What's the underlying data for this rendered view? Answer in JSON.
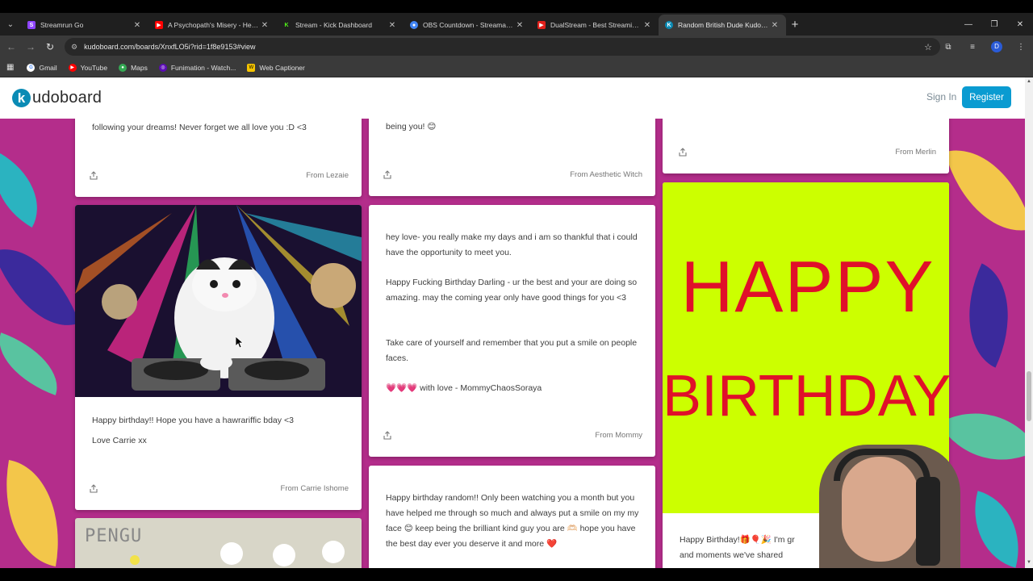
{
  "browser": {
    "tabs": [
      {
        "label": "Streamrun Go",
        "icon": "streamrun-icon",
        "color": "#8e44ff",
        "active": false
      },
      {
        "label": "A Psychopath's Misery - Heartl",
        "icon": "youtube-icon",
        "color": "#ff0000",
        "active": false
      },
      {
        "label": "Stream - Kick Dashboard",
        "icon": "kick-icon",
        "color": "#53fc18",
        "active": false
      },
      {
        "label": "OBS Countdown - Streamable",
        "icon": "chrome-icon",
        "color": "#4285f4",
        "active": false
      },
      {
        "label": "DualStream - Best Streaming Ap",
        "icon": "dualstream-icon",
        "color": "#e0201b",
        "active": false
      },
      {
        "label": "Random British Dude Kudoboar",
        "icon": "kudoboard-icon",
        "color": "#0a8bb5",
        "active": true
      }
    ],
    "url": "kudoboard.com/boards/XnxfLO5i?rid=1f8e9153#view",
    "bookmarks": [
      {
        "label": "Gmail",
        "icon": "google-icon",
        "color": "#ffffff"
      },
      {
        "label": "YouTube",
        "icon": "youtube-icon",
        "color": "#ff0000"
      },
      {
        "label": "Maps",
        "icon": "maps-icon",
        "color": "#34a853"
      },
      {
        "label": "Funimation - Watch...",
        "icon": "funimation-icon",
        "color": "#5b0bb5"
      },
      {
        "label": "Web Captioner",
        "icon": "webcaptioner-icon",
        "color": "#f5c400"
      }
    ]
  },
  "site": {
    "logo_letter": "k",
    "logo_text": "udoboard",
    "signin": "Sign In",
    "register": "Register",
    "accent": "#0a9bd1"
  },
  "cards": {
    "c1": {
      "text": "following your dreams! Never forget we all love you :D <3",
      "from": "From Lezaie"
    },
    "c2": {
      "text": "being you! 😊",
      "from": "From Aesthetic Witch"
    },
    "c3": {
      "from": "From Merlin"
    },
    "c4": {
      "line1": "Happy birthday!! Hope you have a hawrariffic bday <3",
      "line2": "Love Carrie xx",
      "from": "From Carrie Ishome"
    },
    "c5": {
      "p1": "hey love- you really make my days and i am so thankful that i could have the opportunity to meet you.",
      "p2": "Happy Fucking Birthday Darling - ur the best and your are doing so amazing. may the coming year only have good things for you <3",
      "p3": "Take care of yourself and remember that you put a smile on people faces.",
      "p4": "💗💗💗 with love - MommyChaosSoraya",
      "from": "From Mommy"
    },
    "c6": {
      "text": "Happy birthday random!! Only been watching you a month but you have helped me through so much and always put a smile on my my face 😊 keep being the brilliant kind guy you are 🫶🏻 hope you have the best day ever you deserve it and more ❤️"
    },
    "c7": {
      "line1": "HAPPY",
      "line2": "BIRTHDAY",
      "caption": "Happy Birthday!🎁🎈🎉 I'm gr",
      "caption2": "and moments we've shared"
    },
    "c8": {
      "label": "PENGU"
    }
  }
}
